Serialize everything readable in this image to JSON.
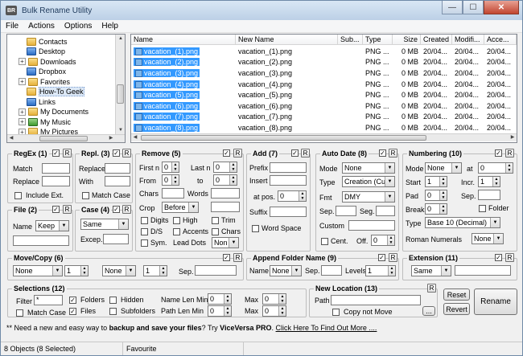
{
  "window": {
    "title": "Bulk Rename Utility",
    "app_icon": "BR"
  },
  "menu": [
    "File",
    "Actions",
    "Options",
    "Help"
  ],
  "tree": {
    "items": [
      {
        "label": "Contacts",
        "exp": "",
        "icon": "folder"
      },
      {
        "label": "Desktop",
        "exp": "",
        "icon": "blue"
      },
      {
        "label": "Downloads",
        "exp": "+",
        "icon": "folder"
      },
      {
        "label": "Dropbox",
        "exp": "",
        "icon": "blue"
      },
      {
        "label": "Favorites",
        "exp": "+",
        "icon": "folder"
      },
      {
        "label": "How-To Geek",
        "exp": "",
        "icon": "folder",
        "selected": true
      },
      {
        "label": "Links",
        "exp": "",
        "icon": "blue"
      },
      {
        "label": "My Documents",
        "exp": "+",
        "icon": "folder"
      },
      {
        "label": "My Music",
        "exp": "+",
        "icon": "green"
      },
      {
        "label": "My Pictures",
        "exp": "+",
        "icon": "folder"
      }
    ]
  },
  "files": {
    "columns": [
      "Name",
      "New Name",
      "Sub...",
      "Type",
      "Size",
      "Created",
      "Modifi...",
      "Acce..."
    ],
    "rows": [
      [
        "vacation_(1).png",
        "vacation_(1).png",
        "",
        "PNG ...",
        "0 MB",
        "20/04...",
        "20/04...",
        "20/04..."
      ],
      [
        "vacation_(2).png",
        "vacation_(2).png",
        "",
        "PNG ...",
        "0 MB",
        "20/04...",
        "20/04...",
        "20/04..."
      ],
      [
        "vacation_(3).png",
        "vacation_(3).png",
        "",
        "PNG ...",
        "0 MB",
        "20/04...",
        "20/04...",
        "20/04..."
      ],
      [
        "vacation_(4).png",
        "vacation_(4).png",
        "",
        "PNG ...",
        "0 MB",
        "20/04...",
        "20/04...",
        "20/04..."
      ],
      [
        "vacation_(5).png",
        "vacation_(5).png",
        "",
        "PNG ...",
        "0 MB",
        "20/04...",
        "20/04...",
        "20/04..."
      ],
      [
        "vacation_(6).png",
        "vacation_(6).png",
        "",
        "PNG ...",
        "0 MB",
        "20/04...",
        "20/04...",
        "20/04..."
      ],
      [
        "vacation_(7).png",
        "vacation_(7).png",
        "",
        "PNG ...",
        "0 MB",
        "20/04...",
        "20/04...",
        "20/04..."
      ],
      [
        "vacation_(8).png",
        "vacation_(8).png",
        "",
        "PNG ...",
        "0 MB",
        "20/04...",
        "20/04...",
        "20/04..."
      ]
    ]
  },
  "regex": {
    "title": "RegEx (1)",
    "match": "Match",
    "replace": "Replace",
    "include_ext": "Include Ext."
  },
  "repl": {
    "title": "Repl. (3)",
    "replace": "Replace",
    "with": "With",
    "match_case": "Match Case"
  },
  "remove": {
    "title": "Remove (5)",
    "first_n": "First n",
    "first_n_val": "0",
    "last_n": "Last n",
    "last_n_val": "0",
    "from": "From",
    "from_val": "0",
    "to": "to",
    "to_val": "0",
    "chars": "Chars",
    "words": "Words",
    "crop": "Crop",
    "crop_val": "Before",
    "digits": "Digits",
    "high": "High",
    "trim": "Trim",
    "ds": "D/S",
    "accents": "Accents",
    "chars2": "Chars",
    "sym": "Sym.",
    "lead_dots": "Lead Dots",
    "lead_val": "Non"
  },
  "add": {
    "title": "Add (7)",
    "prefix": "Prefix",
    "insert": "Insert",
    "at_pos": "at pos.",
    "at_pos_val": "0",
    "suffix": "Suffix",
    "word_space": "Word Space"
  },
  "autodate": {
    "title": "Auto Date (8)",
    "mode": "Mode",
    "mode_val": "None",
    "type": "Type",
    "type_val": "Creation (Cur",
    "fmt": "Fmt",
    "fmt_val": "DMY",
    "sep": "Sep.",
    "seg": "Seg.",
    "custom": "Custom",
    "cent": "Cent.",
    "off": "Off.",
    "off_val": "0"
  },
  "numbering": {
    "title": "Numbering (10)",
    "mode": "Mode",
    "mode_val": "None",
    "at": "at",
    "at_val": "0",
    "start": "Start",
    "start_val": "1",
    "incr": "Incr.",
    "incr_val": "1",
    "pad": "Pad",
    "pad_val": "0",
    "sep": "Sep.",
    "brk": "Break",
    "brk_val": "0",
    "folder": "Folder",
    "type": "Type",
    "type_val": "Base 10 (Decimal)",
    "roman": "Roman Numerals",
    "roman_val": "None"
  },
  "file": {
    "title": "File (2)",
    "name": "Name",
    "name_val": "Keep"
  },
  "case": {
    "title": "Case (4)",
    "case_val": "Same",
    "excep": "Excep."
  },
  "move": {
    "title": "Move/Copy (6)",
    "a_val": "None",
    "b_val": "1",
    "c_val": "None",
    "d_val": "1",
    "sep": "Sep."
  },
  "append": {
    "title": "Append Folder Name (9)",
    "name": "Name",
    "name_val": "None",
    "sep": "Sep.",
    "levels": "Levels",
    "levels_val": "1"
  },
  "ext": {
    "title": "Extension (11)",
    "val": "Same"
  },
  "selections": {
    "title": "Selections (12)",
    "filter": "Filter",
    "filter_val": "*",
    "folders": "Folders",
    "hidden": "Hidden",
    "name_len": "Name Len Min",
    "name_len_val": "0",
    "max": "Max",
    "max_val": "0",
    "match_case": "Match Case",
    "files": "Files",
    "subfolders": "Subfolders",
    "path_len": "Path Len Min",
    "path_len_val": "0",
    "max2": "Max",
    "max2_val": "0"
  },
  "newloc": {
    "title": "New Location (13)",
    "path": "Path",
    "copy_not_move": "Copy not Move",
    "browse": "..."
  },
  "buttons": {
    "r": "R",
    "reset": "Reset",
    "revert": "Revert",
    "rename": "Rename"
  },
  "promo": {
    "pre": "** Need a new and easy way to ",
    "bold": "backup and save your files",
    "mid": "? Try ",
    "product": "ViceVersa PRO",
    "dot": ". ",
    "link": "Click Here To Find Out More ...."
  },
  "status": {
    "objects": "8 Objects (8 Selected)",
    "favourite": "Favourite"
  }
}
